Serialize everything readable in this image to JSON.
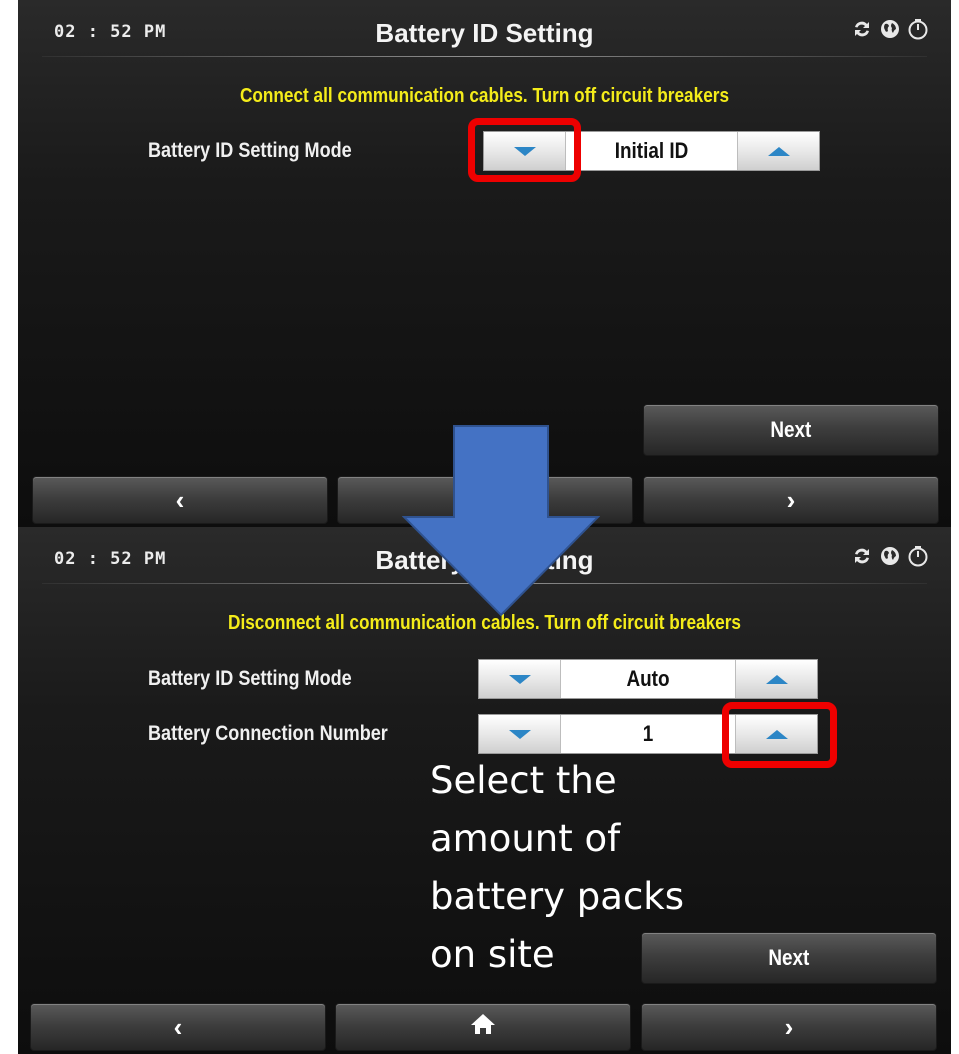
{
  "top_screen": {
    "clock": "02 : 52 PM",
    "title": "Battery ID Setting",
    "warning": "Connect all communication cables. Turn off circuit breakers",
    "mode_label": "Battery ID Setting Mode",
    "mode_value": "Initial ID",
    "next_label": "Next",
    "nav_prev": "‹",
    "nav_next": "›"
  },
  "bottom_screen": {
    "clock": "02 : 52 PM",
    "title": "Battery ID Setting",
    "warning": "Disconnect all communication cables. Turn off circuit breakers",
    "mode_label": "Battery ID Setting Mode",
    "mode_value": "Auto",
    "connection_label": "Battery Connection Number",
    "connection_value": "1",
    "next_label": "Next",
    "nav_prev": "‹",
    "nav_next": "›"
  },
  "annotation": {
    "text": "Select the amount of battery packs on site",
    "highlight_color": "#ee0000",
    "arrow_color": "#4472c4"
  },
  "icons": [
    "refresh-icon",
    "globe-icon",
    "gauge-icon",
    "home-icon",
    "chevron-left-icon",
    "chevron-right-icon"
  ],
  "colors": {
    "warning": "#f4ec1a",
    "spinner_arrow": "#2c86c6"
  }
}
